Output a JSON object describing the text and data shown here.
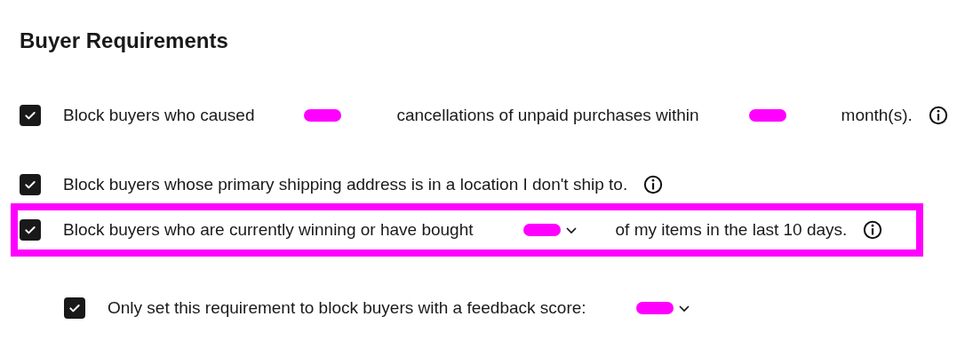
{
  "title": "Buyer Requirements",
  "requirements": [
    {
      "checked": true,
      "info": true,
      "parts": [
        {
          "kind": "text",
          "text": "Block buyers who caused"
        },
        {
          "kind": "select",
          "redacted": true
        },
        {
          "kind": "text",
          "text": "cancellations of unpaid purchases within"
        },
        {
          "kind": "select",
          "redacted": true
        },
        {
          "kind": "text",
          "text": "month(s)."
        }
      ]
    },
    {
      "checked": true,
      "info": true,
      "parts": [
        {
          "kind": "text",
          "text": "Block buyers whose primary shipping address is in a location I don't ship to."
        }
      ]
    },
    {
      "checked": true,
      "highlighted": true,
      "info": true,
      "parts": [
        {
          "kind": "text",
          "text": "Block buyers who are currently winning or have bought"
        },
        {
          "kind": "select",
          "redacted": true,
          "chevron": true
        },
        {
          "kind": "text",
          "text": "of my items in the last 10 days."
        }
      ],
      "children": [
        {
          "checked": true,
          "parts": [
            {
              "kind": "text",
              "text": "Only set this requirement to block buyers with a feedback score:"
            },
            {
              "kind": "select",
              "redacted": true,
              "chevron": true
            }
          ]
        }
      ]
    }
  ]
}
